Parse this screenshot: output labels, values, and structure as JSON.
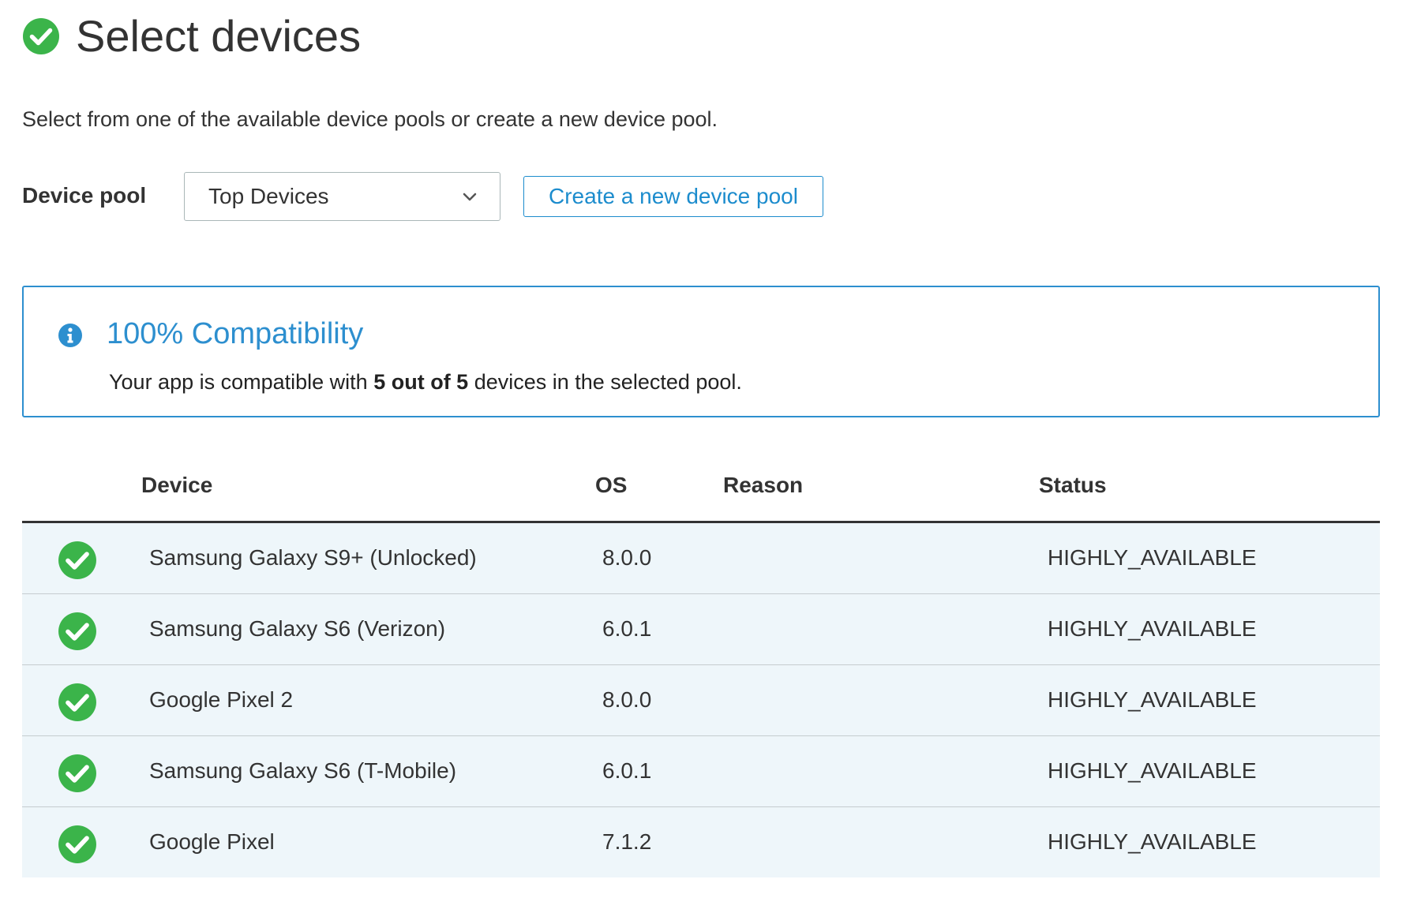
{
  "page": {
    "title": "Select devices",
    "description": "Select from one of the available device pools or create a new device pool."
  },
  "device_pool": {
    "label": "Device pool",
    "selected": "Top Devices",
    "create_button": "Create a new device pool"
  },
  "compatibility": {
    "title": "100% Compatibility",
    "text_before": "Your app is compatible with ",
    "text_bold": "5 out of 5",
    "text_after": " devices in the selected pool."
  },
  "table": {
    "headers": {
      "device": "Device",
      "os": "OS",
      "reason": "Reason",
      "status": "Status"
    },
    "rows": [
      {
        "device": "Samsung Galaxy S9+ (Unlocked)",
        "os": "8.0.0",
        "reason": "",
        "status": "HIGHLY_AVAILABLE"
      },
      {
        "device": "Samsung Galaxy S6 (Verizon)",
        "os": "6.0.1",
        "reason": "",
        "status": "HIGHLY_AVAILABLE"
      },
      {
        "device": "Google Pixel 2",
        "os": "8.0.0",
        "reason": "",
        "status": "HIGHLY_AVAILABLE"
      },
      {
        "device": "Samsung Galaxy S6 (T-Mobile)",
        "os": "6.0.1",
        "reason": "",
        "status": "HIGHLY_AVAILABLE"
      },
      {
        "device": "Google Pixel",
        "os": "7.1.2",
        "reason": "",
        "status": "HIGHLY_AVAILABLE"
      }
    ]
  },
  "icons": {
    "title_icon": "check-circle-icon",
    "dropdown_icon": "chevron-down-icon",
    "info_icon": "info-icon",
    "row_icon": "check-circle-icon"
  },
  "colors": {
    "success_green": "#3bb44a",
    "link_blue": "#1c8ccd",
    "info_blue": "#2d8fcf",
    "row_background": "#eef6fa"
  }
}
